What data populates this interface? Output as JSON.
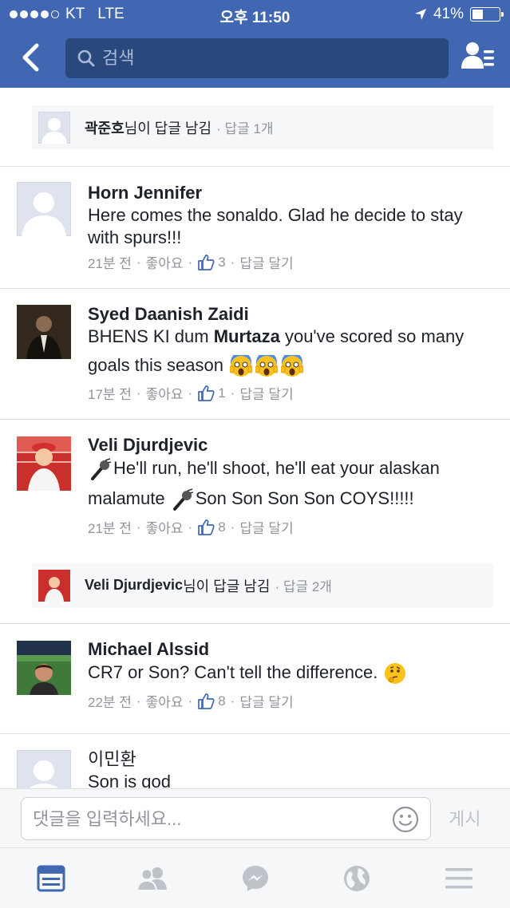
{
  "status_bar": {
    "carrier": "KT",
    "network": "LTE",
    "time": "오후 11:50",
    "battery_text": "41%",
    "battery_level": 0.41
  },
  "header": {
    "search_placeholder": "검색"
  },
  "reply_summaries": [
    {
      "name": "곽준호",
      "suffix": "님이 답글 남김",
      "count": "· 답글 1개"
    },
    {
      "name": "Veli Djurdjevic",
      "suffix": "님이 답글 남김",
      "count": "· 답글 2개"
    }
  ],
  "comments": [
    {
      "author": "Horn Jennifer",
      "text": "Here comes the sonaldo. Glad he decide to stay with spurs!!!",
      "time": "21분 전",
      "like_label": "좋아요",
      "likes": "3",
      "reply_label": "답글 달기"
    },
    {
      "author": "Syed Daanish Zaidi",
      "text_before": "BHENS KI dum ",
      "mention": "Murtaza",
      "text_after": " you've scored so many goals this season",
      "time": "17분 전",
      "like_label": "좋아요",
      "likes": "1",
      "reply_label": "답글 달기"
    },
    {
      "author": "Veli Djurdjevic",
      "text_part1": "He'll run, he'll shoot, he'll eat your alaskan malamute ",
      "text_part2": "Son Son Son Son COYS!!!!!",
      "time": "21분 전",
      "like_label": "좋아요",
      "likes": "8",
      "reply_label": "답글 달기"
    },
    {
      "author": "Michael Alssid",
      "text": "CR7 or Son? Can't tell the difference.",
      "time": "22분 전",
      "like_label": "좋아요",
      "likes": "8",
      "reply_label": "답글 달기"
    },
    {
      "author": "이민환",
      "text": "Son is god"
    }
  ],
  "composer": {
    "placeholder": "댓글을 입력하세요...",
    "post_label": "게시"
  },
  "tabbar": {
    "icons": [
      "news-feed-icon",
      "friends-icon",
      "messenger-icon",
      "globe-notifications-icon",
      "menu-icon"
    ],
    "active": "news-feed-icon"
  },
  "colors": {
    "brand": "#4267b2",
    "search_bg": "#29487d",
    "meta_gray": "#90949c",
    "like_blue": "#4267b2"
  }
}
